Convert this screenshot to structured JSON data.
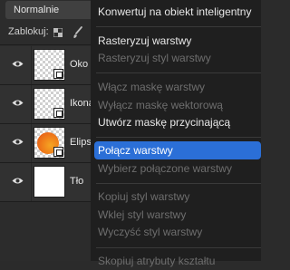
{
  "layers_panel": {
    "blend_mode": "Normalnie",
    "lock_label": "Zablokuj:",
    "layers": [
      {
        "name": "Oko",
        "thumb": "transparent",
        "smart_object": true
      },
      {
        "name": "Ikona",
        "thumb": "transparent",
        "smart_object": true
      },
      {
        "name": "Elipsa",
        "thumb": "ellipse",
        "smart_object": true
      },
      {
        "name": "Tło",
        "thumb": "white",
        "smart_object": false
      }
    ]
  },
  "context_menu": {
    "items": [
      {
        "label": "Konwertuj na obiekt inteligentny",
        "enabled": true
      },
      {
        "label": "Rasteryzuj warstwy",
        "enabled": true
      },
      {
        "label": "Rasteryzuj styl warstwy",
        "enabled": false
      },
      {
        "label": "Włącz maskę warstwy",
        "enabled": false
      },
      {
        "label": "Wyłącz maskę wektorową",
        "enabled": false
      },
      {
        "label": "Utwórz maskę przycinającą",
        "enabled": true
      },
      {
        "label": "Połącz warstwy",
        "enabled": true,
        "highlighted": true
      },
      {
        "label": "Wybierz połączone warstwy",
        "enabled": false
      },
      {
        "label": "Kopiuj styl warstwy",
        "enabled": false
      },
      {
        "label": "Wklej styl warstwy",
        "enabled": false
      },
      {
        "label": "Wyczyść styl warstwy",
        "enabled": false
      },
      {
        "label": "Skopiuj atrybuty kształtu",
        "enabled": false
      }
    ]
  },
  "colors": {
    "highlight": "#2b6fd7",
    "menu_background": "#1f1f1f",
    "panel_background": "#2c2c2c"
  }
}
